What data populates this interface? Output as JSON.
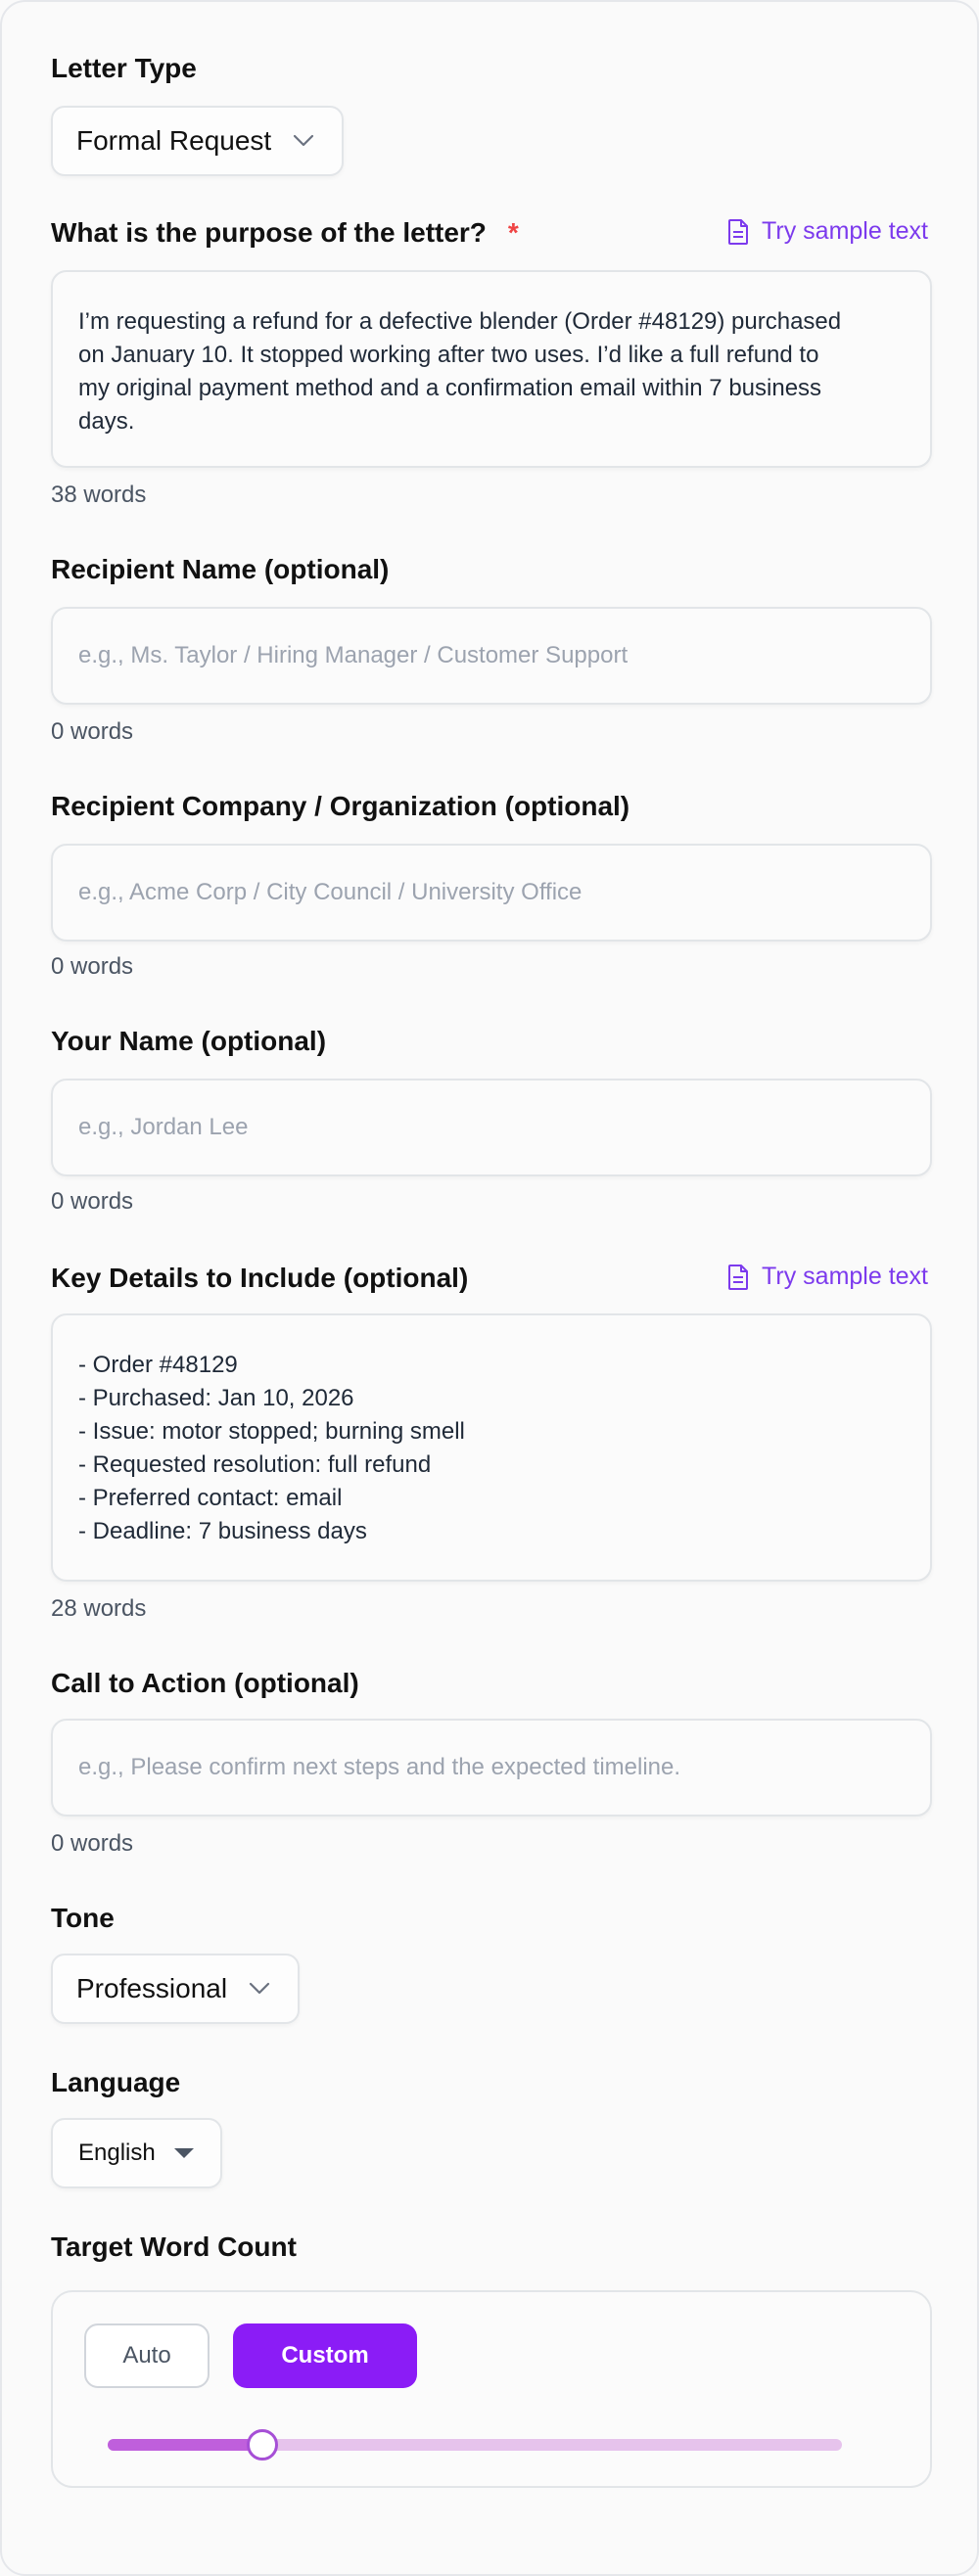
{
  "letter_type": {
    "label": "Letter Type",
    "value": "Formal Request"
  },
  "purpose": {
    "label": "What is the purpose of the letter?",
    "required_mark": "*",
    "sample_link": "Try sample text",
    "value": "I’m requesting a refund for a defective blender (Order #48129) purchased\non January 10. It stopped working after two uses. I’d like a full refund to\nmy original payment method and a confirmation email within 7 business\ndays.",
    "word_count": "38 words"
  },
  "recipient_name": {
    "label": "Recipient Name (optional)",
    "placeholder": "e.g., Ms. Taylor / Hiring Manager / Customer Support",
    "word_count": "0 words"
  },
  "recipient_company": {
    "label": "Recipient Company / Organization (optional)",
    "placeholder": "e.g., Acme Corp / City Council / University Office",
    "word_count": "0 words"
  },
  "your_name": {
    "label": "Your Name (optional)",
    "placeholder": "e.g., Jordan Lee",
    "word_count": "0 words"
  },
  "key_details": {
    "label": "Key Details to Include (optional)",
    "sample_link": "Try sample text",
    "value": "- Order #48129\n- Purchased: Jan 10, 2026\n- Issue: motor stopped; burning smell\n- Requested resolution: full refund\n- Preferred contact: email\n- Deadline: 7 business days",
    "word_count": "28 words"
  },
  "call_to_action": {
    "label": "Call to Action (optional)",
    "placeholder": "e.g., Please confirm next steps and the expected timeline.",
    "word_count": "0 words"
  },
  "tone": {
    "label": "Tone",
    "value": "Professional"
  },
  "language": {
    "label": "Language",
    "value": "English"
  },
  "target_word_count": {
    "label": "Target Word Count",
    "auto_label": "Auto",
    "custom_label": "Custom",
    "slider_fraction": 0.21
  },
  "colors": {
    "accent": "#8b1cf6",
    "link": "#7c3aed",
    "required": "#ef4444"
  },
  "icons": {
    "sample": "document-icon",
    "dropdown": "chevron-down-icon",
    "language_dropdown": "caret-down-icon"
  }
}
